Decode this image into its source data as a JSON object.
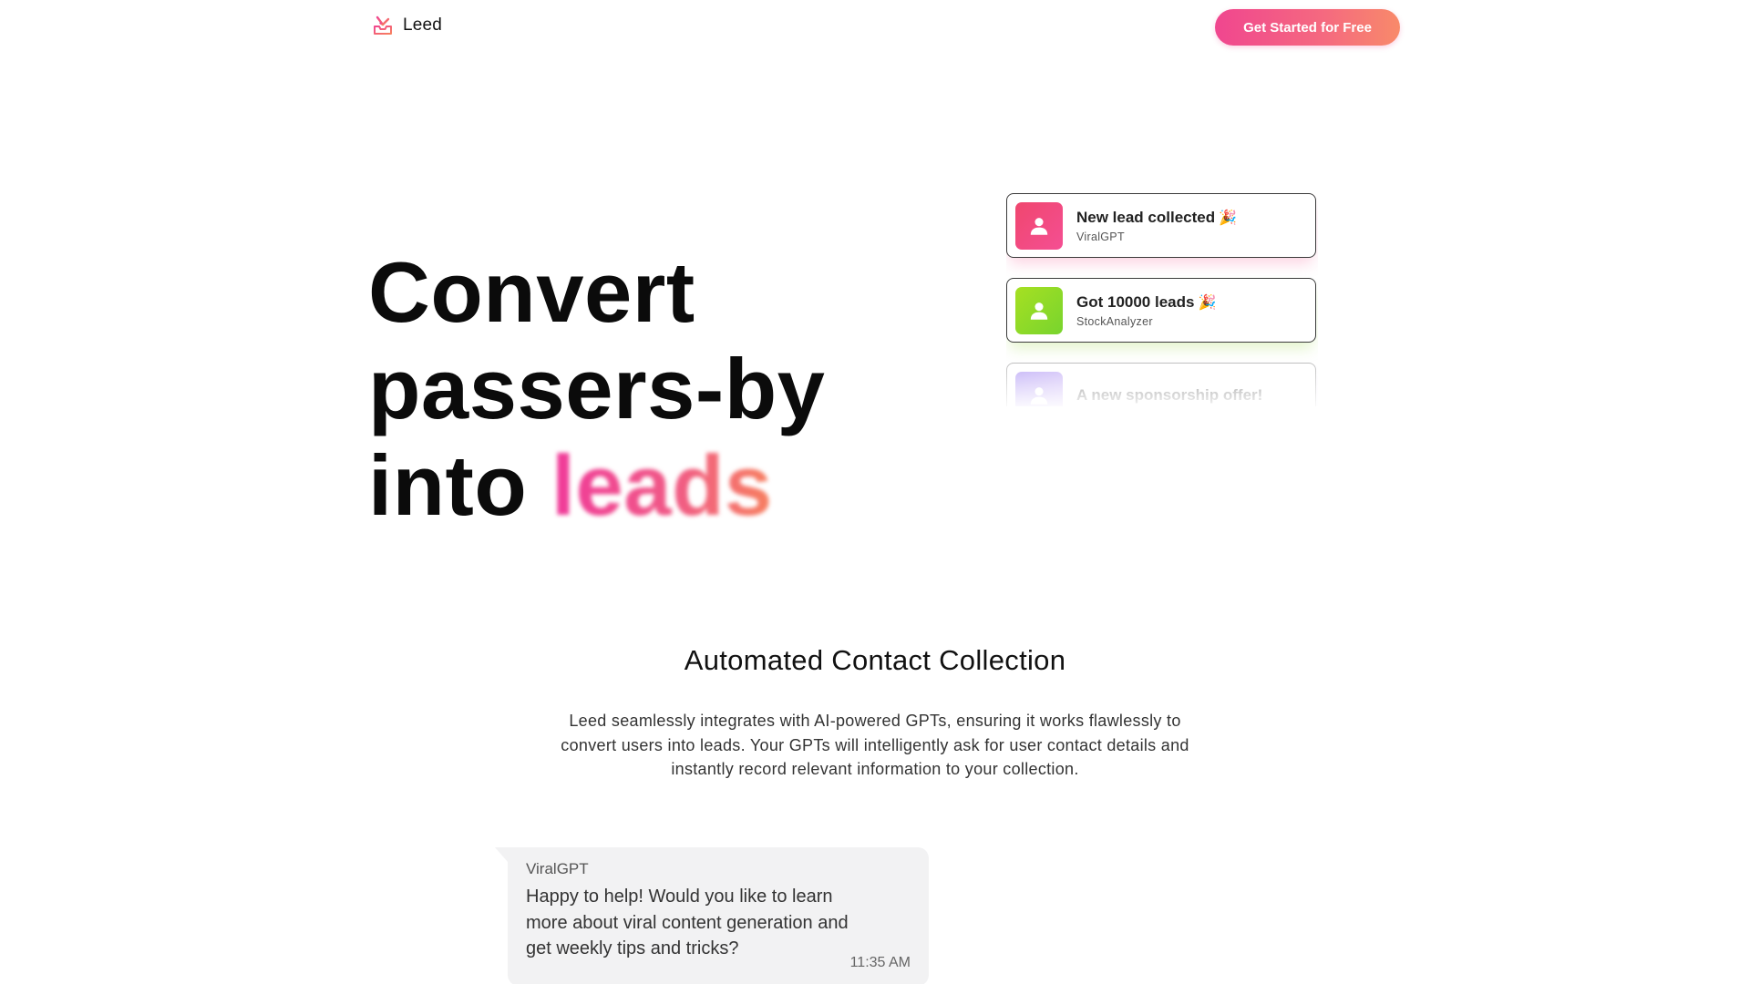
{
  "header": {
    "logo_text": "Leed",
    "cta_label": "Get Started for Free"
  },
  "hero": {
    "line1": "Convert",
    "line2": "passers-by",
    "line3_prefix": "into",
    "highlight": "leads"
  },
  "notifications": [
    {
      "title": "New lead collected",
      "emoji": "🎉",
      "source": "ViralGPT",
      "icon": "user-icon",
      "color_from": "#f0466e",
      "color_to": "#f44f93"
    },
    {
      "title": "Got 10000 leads",
      "emoji": "🎉",
      "source": "StockAnalyzer",
      "icon": "user-icon",
      "color_from": "#a6e022",
      "color_to": "#78d42e"
    },
    {
      "title": "A new sponsorship offer!",
      "emoji": "",
      "source": "",
      "icon": "user-icon",
      "color_from": "#8c6cf0",
      "color_to": "#c5a6f5"
    }
  ],
  "features": {
    "title": "Automated Contact Collection",
    "description": "Leed seamlessly integrates with AI-powered GPTs, ensuring it works flawlessly to convert users into leads. Your GPTs will intelligently ask for user contact details and instantly record relevant information to your collection."
  },
  "chat": {
    "sender": "ViralGPT",
    "message": "Happy to help! Would you like to learn more about viral content generation and get weekly tips and tricks?",
    "time": "11:35 AM"
  },
  "colors": {
    "accent_pink": "#f0468f",
    "accent_orange": "#f88a6a",
    "bubble_bg": "#f2f2f3"
  }
}
